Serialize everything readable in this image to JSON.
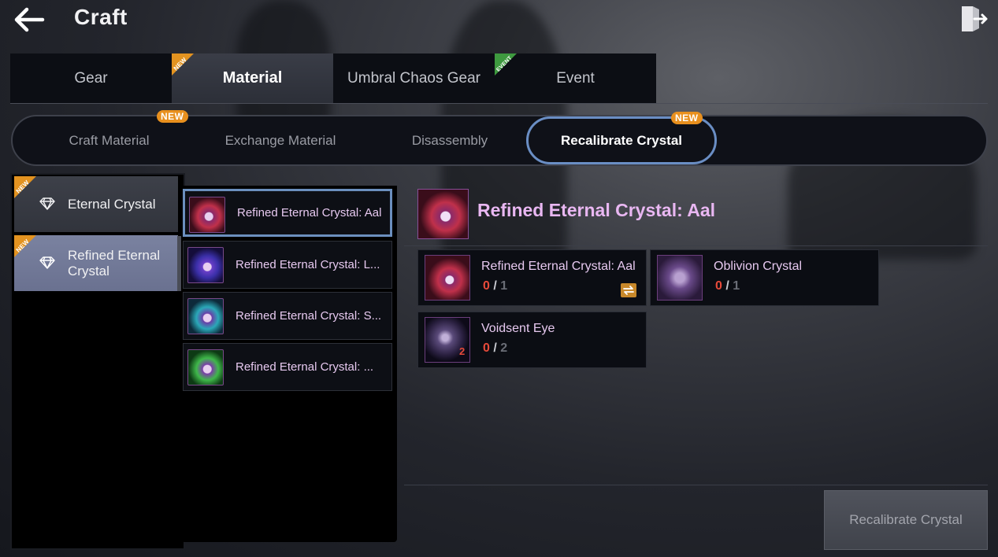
{
  "header": {
    "title": "Craft",
    "back_icon": "arrow-left-icon",
    "exit_icon": "exit-door-icon"
  },
  "main_tabs": [
    {
      "label": "Gear",
      "active": false,
      "ribbon": ""
    },
    {
      "label": "Material",
      "active": true,
      "ribbon": "NEW"
    },
    {
      "label": "Umbral Chaos Gear",
      "active": false,
      "ribbon": ""
    },
    {
      "label": "Event",
      "active": false,
      "ribbon": "EVENT"
    }
  ],
  "sub_tabs": [
    {
      "label": "Craft Material",
      "badge": "NEW",
      "active": false
    },
    {
      "label": "Exchange Material",
      "badge": "",
      "active": false
    },
    {
      "label": "Disassembly",
      "badge": "",
      "active": false
    },
    {
      "label": "Recalibrate Crystal",
      "badge": "NEW",
      "active": true
    }
  ],
  "categories": [
    {
      "label": "Eternal Crystal",
      "ribbon": "NEW",
      "icon": "diamond-icon",
      "active": false
    },
    {
      "label": "Refined Eternal Crystal",
      "ribbon": "NEW",
      "icon": "diamond-icon",
      "active": true
    }
  ],
  "recipes": [
    {
      "label": "Refined Eternal Crystal: Aal",
      "color": "#c0304a",
      "selected": true
    },
    {
      "label": "Refined Eternal Crystal: L...",
      "color": "#4a3fc8",
      "selected": false
    },
    {
      "label": "Refined Eternal Crystal: S...",
      "color": "#2aa8b8",
      "selected": false
    },
    {
      "label": "Refined Eternal Crystal: ...",
      "color": "#3fb84a",
      "selected": false
    }
  ],
  "detail": {
    "title": "Refined Eternal Crystal: Aal",
    "materials": [
      {
        "name": "Refined Eternal Crystal: Aal",
        "have": "0",
        "need": "1",
        "color": "#c0304a",
        "swap_icon": "swap-icon"
      },
      {
        "name": "Oblivion Crystal",
        "have": "0",
        "need": "1",
        "color": "#6a4a8a"
      },
      {
        "name": "Voidsent Eye",
        "have": "0",
        "need": "2",
        "stack": "2",
        "color": "#5a4a7a"
      }
    ],
    "qty_separator": " / ",
    "action_label": "Recalibrate Crystal"
  },
  "colors": {
    "accent": "#6a8ec4",
    "new_badge": "#e8901e",
    "event_ribbon": "#3e9a3f",
    "qty_missing": "#e74a3a",
    "title_purple": "#e9b7f2"
  }
}
